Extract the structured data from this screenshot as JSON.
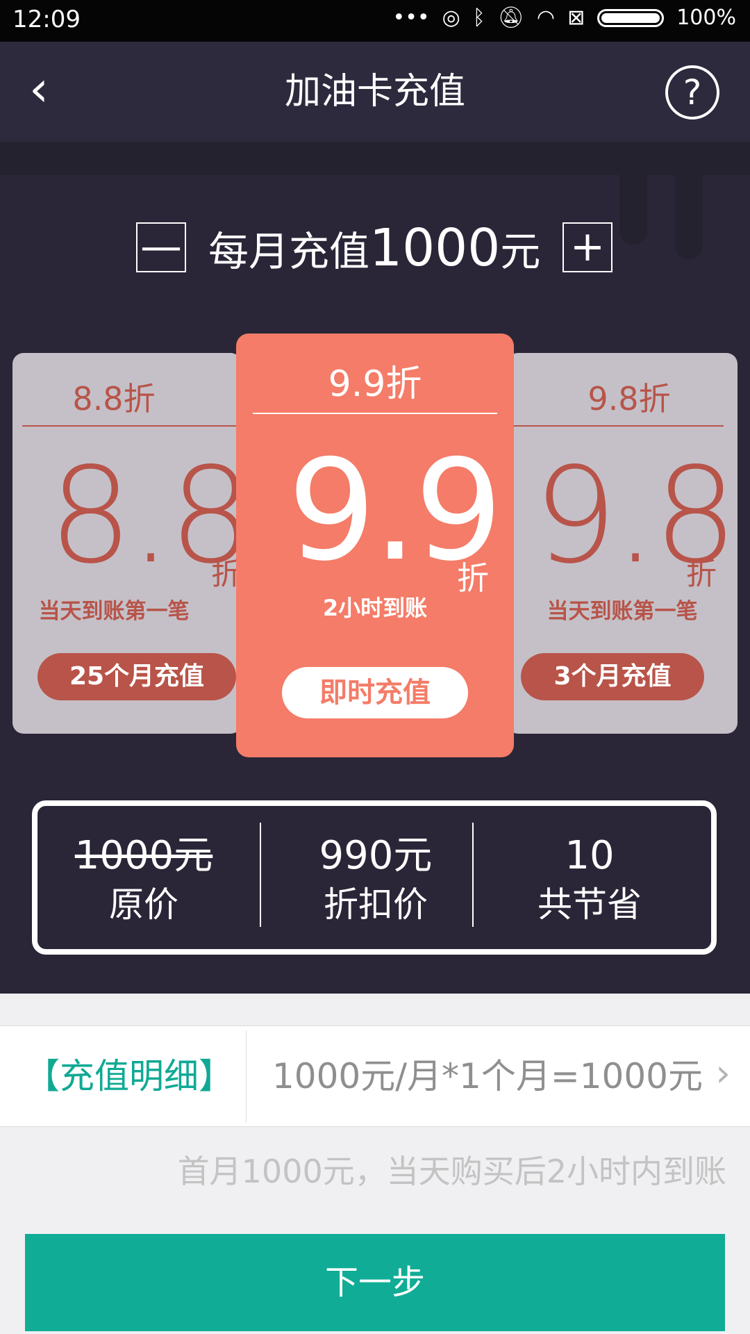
{
  "status_bar": {
    "time": "12:09",
    "icons": [
      "more-dots-icon",
      "hotspot-icon",
      "bluetooth-icon",
      "bell-off-icon",
      "wifi-icon",
      "sim-icon",
      "battery-icon"
    ],
    "battery_percent": "100%"
  },
  "header": {
    "title": "加油卡充值",
    "back_icon": "‹",
    "help_icon": "?"
  },
  "stepper": {
    "minus_label": "—",
    "plus_label": "+",
    "prefix": "每月充值",
    "amount": "1000",
    "suffix": "元"
  },
  "plans": {
    "left": {
      "title": "8.8折",
      "big": "8.8",
      "unit": "折",
      "subtitle": "当天到账第一笔",
      "button": "25个月充值"
    },
    "center": {
      "title": "9.9折",
      "big": "9.9",
      "unit": "折",
      "subtitle": "2小时到账",
      "button": "即时充值"
    },
    "right": {
      "title": "9.8折",
      "big": "9.8",
      "unit": "折",
      "subtitle": "当天到账第一笔",
      "button": "3个月充值"
    }
  },
  "summary": {
    "original_price": "1000元",
    "original_label": "原价",
    "discount_price": "990元",
    "discount_label": "折扣价",
    "savings": "10",
    "savings_label": "共节省"
  },
  "detail": {
    "label": "【充值明细】",
    "value": "1000元/月*1个月=1000元",
    "chevron": "›"
  },
  "note": "首月1000元，当天购买后2小时内到账",
  "next_button": "下一步",
  "colors": {
    "dark_bg": "#2a2637",
    "header_bg": "#2d2a3d",
    "coral": "#f47c68",
    "card_gray": "#c5c0c8",
    "accent_red": "#b85449",
    "teal": "#10ac96"
  }
}
